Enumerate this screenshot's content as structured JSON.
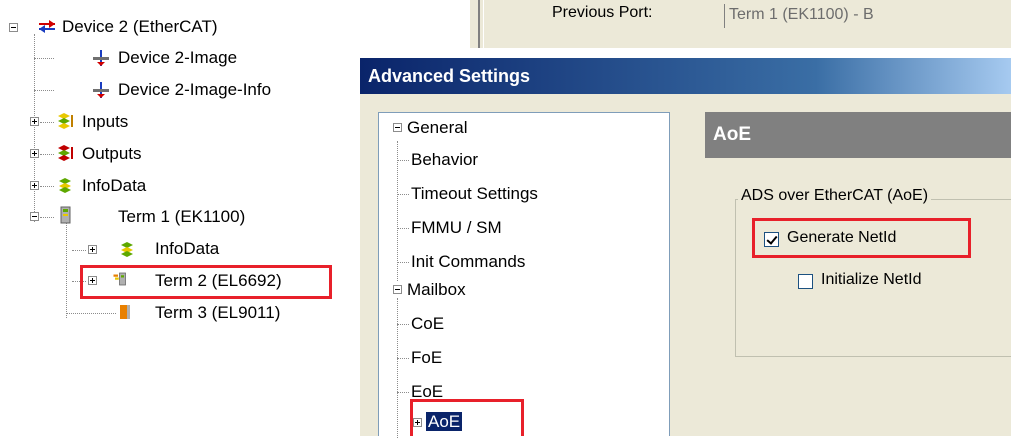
{
  "left_tree": {
    "device": "Device 2 (EtherCAT)",
    "image": "Device 2-Image",
    "image_info": "Device 2-Image-Info",
    "inputs": "Inputs",
    "outputs": "Outputs",
    "infodata": "InfoData",
    "term1": "Term 1 (EK1100)",
    "term1_infodata": "InfoData",
    "term2": "Term 2 (EL6692)",
    "term3": "Term 3 (EL9011)"
  },
  "background_panel": {
    "previous_port_label": "Previous Port:",
    "previous_port_value": "Term 1 (EK1100) - B"
  },
  "dialog": {
    "title": "Advanced Settings",
    "tree": {
      "general": "General",
      "general_items": [
        "Behavior",
        "Timeout Settings",
        "FMMU / SM",
        "Init Commands"
      ],
      "mailbox": "Mailbox",
      "mailbox_items": [
        "CoE",
        "FoE",
        "EoE"
      ],
      "aoe": "AoE"
    },
    "section_header": "AoE",
    "group_title": "ADS over EtherCAT (AoE)",
    "generate_netid": {
      "label": "Generate NetId",
      "checked": true
    },
    "initialize_netid": {
      "label": "Initialize NetId",
      "checked": false
    }
  },
  "colors": {
    "highlight_red": "#e8202a",
    "selection_blue": "#0a246a",
    "dialog_bg": "#ece9d8"
  }
}
